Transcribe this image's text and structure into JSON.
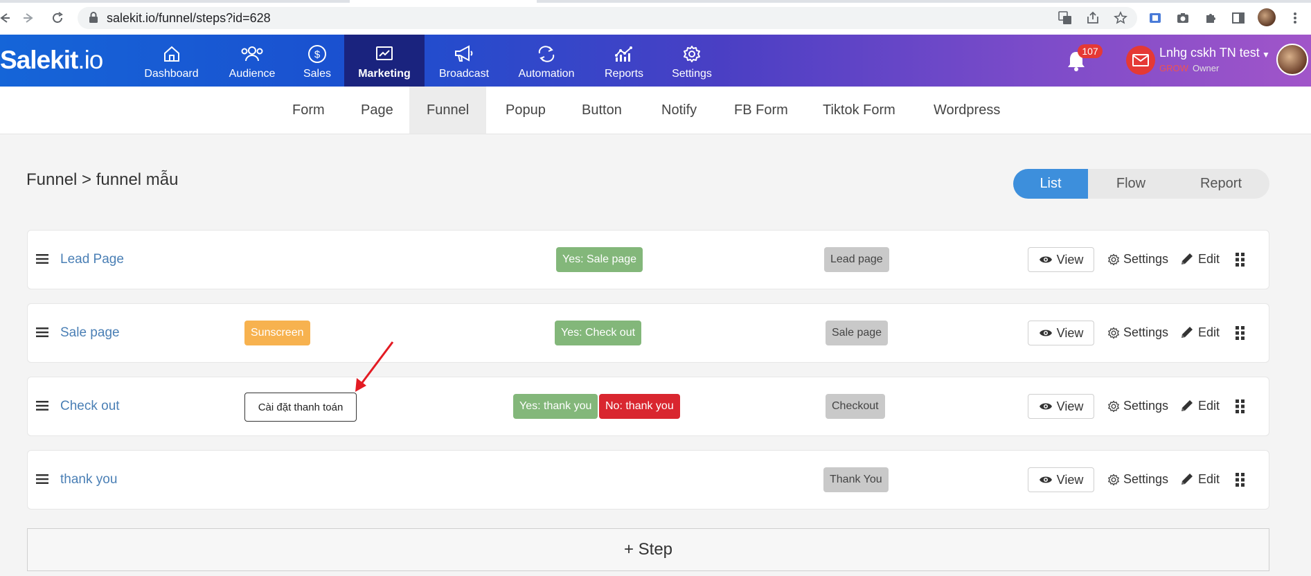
{
  "browser": {
    "url": "salekit.io/funnel/steps?id=628"
  },
  "app": {
    "logo_main": "Salekit",
    "logo_suffix": ".io",
    "nav": [
      {
        "label": "Dashboard"
      },
      {
        "label": "Audience"
      },
      {
        "label": "Sales"
      },
      {
        "label": "Marketing"
      },
      {
        "label": "Broadcast"
      },
      {
        "label": "Automation"
      },
      {
        "label": "Reports"
      },
      {
        "label": "Settings"
      }
    ],
    "active_nav": "Marketing",
    "notification_count": "107",
    "user": {
      "name": "Lnhg cskh TN test",
      "plan": "GROW",
      "role": "Owner"
    }
  },
  "subnav": {
    "items": [
      "Form",
      "Page",
      "Funnel",
      "Popup",
      "Button",
      "Notify",
      "FB Form",
      "Tiktok Form",
      "Wordpress"
    ],
    "active": "Funnel"
  },
  "page": {
    "breadcrumb": "Funnel > funnel mẫu",
    "view_tabs": [
      "List",
      "Flow",
      "Report"
    ],
    "active_view": "List"
  },
  "steps": [
    {
      "title": "Lead Page",
      "yes_tag": "Yes: Sale page",
      "type": "Lead page"
    },
    {
      "title": "Sale page",
      "product_tag": "Sunscreen",
      "yes_tag": "Yes: Check out",
      "type": "Sale page"
    },
    {
      "title": "Check out",
      "note": "Cài đặt thanh toán",
      "yes_tag": "Yes: thank you",
      "no_tag": "No: thank you",
      "type": "Checkout"
    },
    {
      "title": "thank you",
      "type": "Thank You"
    }
  ],
  "actions": {
    "view": "View",
    "settings": "Settings",
    "edit": "Edit"
  },
  "add_step_label": "+ Step",
  "colors": {
    "accent_blue": "#3d8fdc",
    "active_nav_bg": "#1a237e",
    "tag_green": "#83b77a",
    "tag_red": "#d9262f",
    "tag_orange": "#f7b24f",
    "annotation_arrow": "#e31b23"
  }
}
